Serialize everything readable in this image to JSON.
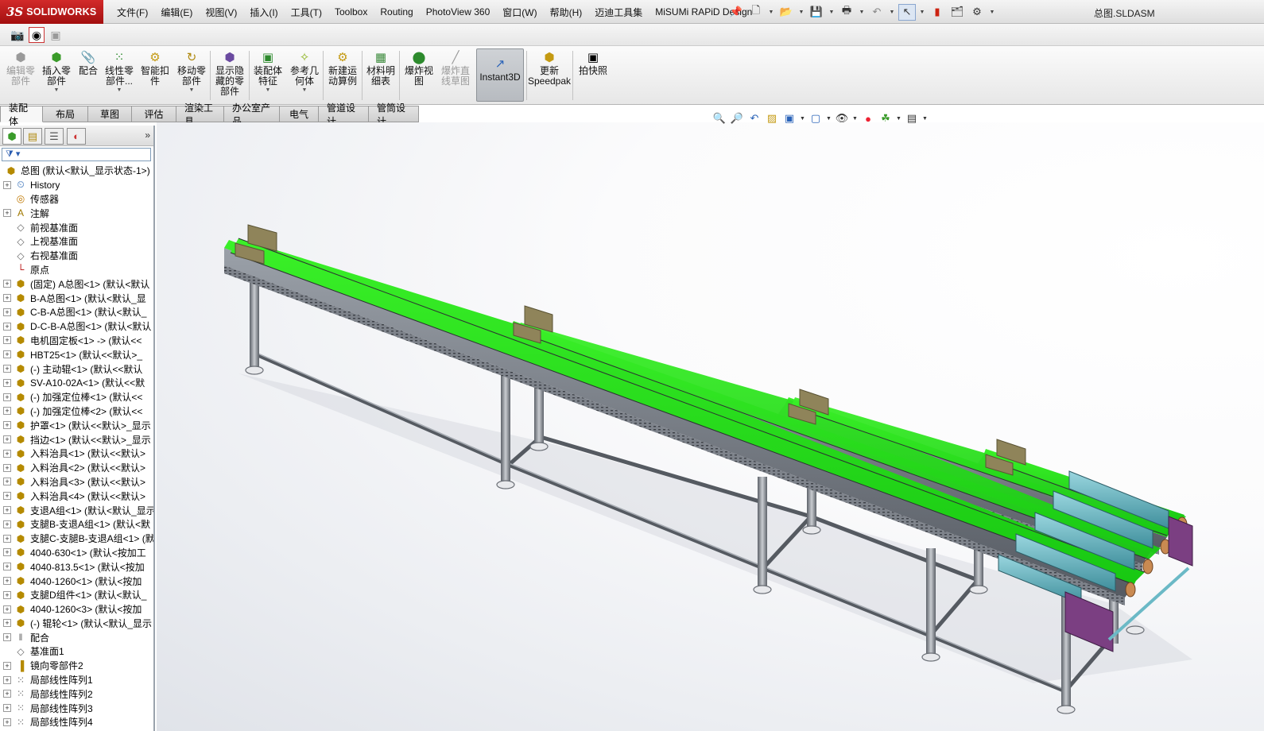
{
  "app": {
    "logo_ds": "3S",
    "logo_text": "SOLIDWORKS",
    "document_title": "总图.SLDASM"
  },
  "menu": [
    "文件(F)",
    "编辑(E)",
    "视图(V)",
    "插入(I)",
    "工具(T)",
    "Toolbox",
    "Routing",
    "PhotoView 360",
    "窗口(W)",
    "帮助(H)",
    "迈迪工具集",
    "MiSUMi RAPiD Design"
  ],
  "quick_access": [
    "pin-icon",
    "new-document-icon",
    "open-icon",
    "save-icon",
    "print-icon",
    "undo-icon",
    "select-icon",
    "rebuild-icon",
    "file-properties-icon",
    "options-icon"
  ],
  "command_manager": {
    "buttons": [
      {
        "label": "编辑零\n部件",
        "icon": "edit-component-icon",
        "disabled": true
      },
      {
        "label": "插入零\n部件",
        "icon": "insert-component-icon",
        "disabled": false,
        "dropdown": true
      },
      {
        "label": "配合",
        "icon": "mate-icon",
        "disabled": false
      },
      {
        "label": "线性零\n部件...",
        "icon": "linear-pattern-icon",
        "disabled": false,
        "dropdown": true
      },
      {
        "label": "智能扣\n件",
        "icon": "smart-fastener-icon",
        "disabled": false
      },
      {
        "label": "移动零\n部件",
        "icon": "move-component-icon",
        "disabled": false,
        "dropdown": true
      },
      {
        "label": "显示隐\n藏的零\n部件",
        "icon": "show-hidden-icon",
        "disabled": false
      },
      {
        "label": "装配体\n特征",
        "icon": "assembly-feature-icon",
        "disabled": false,
        "dropdown": true
      },
      {
        "label": "参考几\n何体",
        "icon": "reference-geometry-icon",
        "disabled": false,
        "dropdown": true
      },
      {
        "label": "新建运\n动算例",
        "icon": "motion-study-icon",
        "disabled": false
      },
      {
        "label": "材料明\n细表",
        "icon": "bom-icon",
        "disabled": false
      },
      {
        "label": "爆炸视\n图",
        "icon": "exploded-view-icon",
        "disabled": false
      },
      {
        "label": "爆炸直\n线草图",
        "icon": "explode-line-sketch-icon",
        "disabled": true
      },
      {
        "label": "Instant3D",
        "icon": "instant3d-icon",
        "disabled": false,
        "active": true
      },
      {
        "label": "更新\nSpeedpak",
        "icon": "speedpak-icon",
        "disabled": false
      },
      {
        "label": "拍快照",
        "icon": "snapshot-icon",
        "disabled": false
      }
    ]
  },
  "tabs": [
    "装配体",
    "布局",
    "草图",
    "评估",
    "渲染工具",
    "办公室产品",
    "电气",
    "管道设计",
    "管筒设计"
  ],
  "active_tab": "装配体",
  "feature_tree": {
    "root": "总图 (默认<默认_显示状态-1>)",
    "items": [
      {
        "label": "History",
        "icon": "history-icon",
        "expand": true
      },
      {
        "label": "传感器",
        "icon": "sensor-icon",
        "expand": false
      },
      {
        "label": "注解",
        "icon": "annotation-icon",
        "expand": true
      },
      {
        "label": "前视基准面",
        "icon": "plane-icon",
        "expand": false
      },
      {
        "label": "上视基准面",
        "icon": "plane-icon",
        "expand": false
      },
      {
        "label": "右视基准面",
        "icon": "plane-icon",
        "expand": false
      },
      {
        "label": "原点",
        "icon": "origin-icon",
        "expand": false
      },
      {
        "label": "(固定) A总图<1> (默认<默认",
        "icon": "subassembly-icon",
        "expand": true
      },
      {
        "label": "B-A总图<1> (默认<默认_显",
        "icon": "subassembly-icon",
        "expand": true
      },
      {
        "label": "C-B-A总图<1> (默认<默认_",
        "icon": "subassembly-icon",
        "expand": true
      },
      {
        "label": "D-C-B-A总图<1> (默认<默认",
        "icon": "subassembly-icon",
        "expand": true
      },
      {
        "label": "电机固定板<1> -> (默认<<",
        "icon": "part-icon",
        "expand": true
      },
      {
        "label": "HBT25<1> (默认<<默认>_",
        "icon": "part-icon",
        "expand": true
      },
      {
        "label": "(-) 主动辊<1> (默认<<默认",
        "icon": "part-icon",
        "expand": true
      },
      {
        "label": "SV-A10-02A<1> (默认<<默",
        "icon": "part-icon",
        "expand": true
      },
      {
        "label": "(-) 加强定位棒<1> (默认<<",
        "icon": "part-icon",
        "expand": true
      },
      {
        "label": "(-) 加强定位棒<2> (默认<<",
        "icon": "part-icon",
        "expand": true
      },
      {
        "label": "护罩<1> (默认<<默认>_显示",
        "icon": "part-icon",
        "expand": true
      },
      {
        "label": "挡边<1> (默认<<默认>_显示",
        "icon": "part-icon",
        "expand": true
      },
      {
        "label": "入料治具<1> (默认<<默认>",
        "icon": "part-icon",
        "expand": true
      },
      {
        "label": "入料治具<2> (默认<<默认>",
        "icon": "part-icon",
        "expand": true
      },
      {
        "label": "入料治具<3> (默认<<默认>",
        "icon": "part-icon",
        "expand": true
      },
      {
        "label": "入料治具<4> (默认<<默认>",
        "icon": "part-icon",
        "expand": true
      },
      {
        "label": "支退A组<1> (默认<默认_显示",
        "icon": "subassembly-icon",
        "expand": true
      },
      {
        "label": "支腿B-支退A组<1> (默认<默",
        "icon": "subassembly-icon",
        "expand": true
      },
      {
        "label": "支腿C-支腿B-支退A组<1> (默",
        "icon": "subassembly-icon",
        "expand": true
      },
      {
        "label": "4040-630<1> (默认<按加工",
        "icon": "part-icon",
        "expand": true
      },
      {
        "label": "4040-813.5<1> (默认<按加",
        "icon": "part-icon",
        "expand": true
      },
      {
        "label": "4040-1260<1> (默认<按加",
        "icon": "part-icon",
        "expand": true
      },
      {
        "label": "支腿D组件<1> (默认<默认_",
        "icon": "subassembly-icon",
        "expand": true
      },
      {
        "label": "4040-1260<3> (默认<按加",
        "icon": "part-icon",
        "expand": true
      },
      {
        "label": "(-) 辊轮<1> (默认<默认_显示",
        "icon": "part-icon",
        "expand": true
      },
      {
        "label": "配合",
        "icon": "mates-icon",
        "expand": true
      },
      {
        "label": "基准面1",
        "icon": "plane-icon",
        "expand": false
      },
      {
        "label": "镜向零部件2",
        "icon": "mirror-component-icon",
        "expand": true
      },
      {
        "label": "局部线性阵列1",
        "icon": "local-pattern-icon",
        "expand": true
      },
      {
        "label": "局部线性阵列2",
        "icon": "local-pattern-icon",
        "expand": true
      },
      {
        "label": "局部线性阵列3",
        "icon": "local-pattern-icon",
        "expand": true
      },
      {
        "label": "局部线性阵列4",
        "icon": "local-pattern-icon",
        "expand": true
      }
    ]
  },
  "view_toolbar": [
    "zoom-to-fit-icon",
    "zoom-area-icon",
    "previous-view-icon",
    "section-view-icon",
    "view-orientation-icon",
    "display-style-icon",
    "hide-show-icon",
    "appearance-icon",
    "scene-icon",
    "view-settings-icon"
  ],
  "colors": {
    "belt": "#22d81a",
    "frame": "#7a7f87",
    "guard": "#8c7f52",
    "motor": "#6bb9c6",
    "drive_plate": "#7b3f82",
    "logo_red": "#c0161b"
  }
}
